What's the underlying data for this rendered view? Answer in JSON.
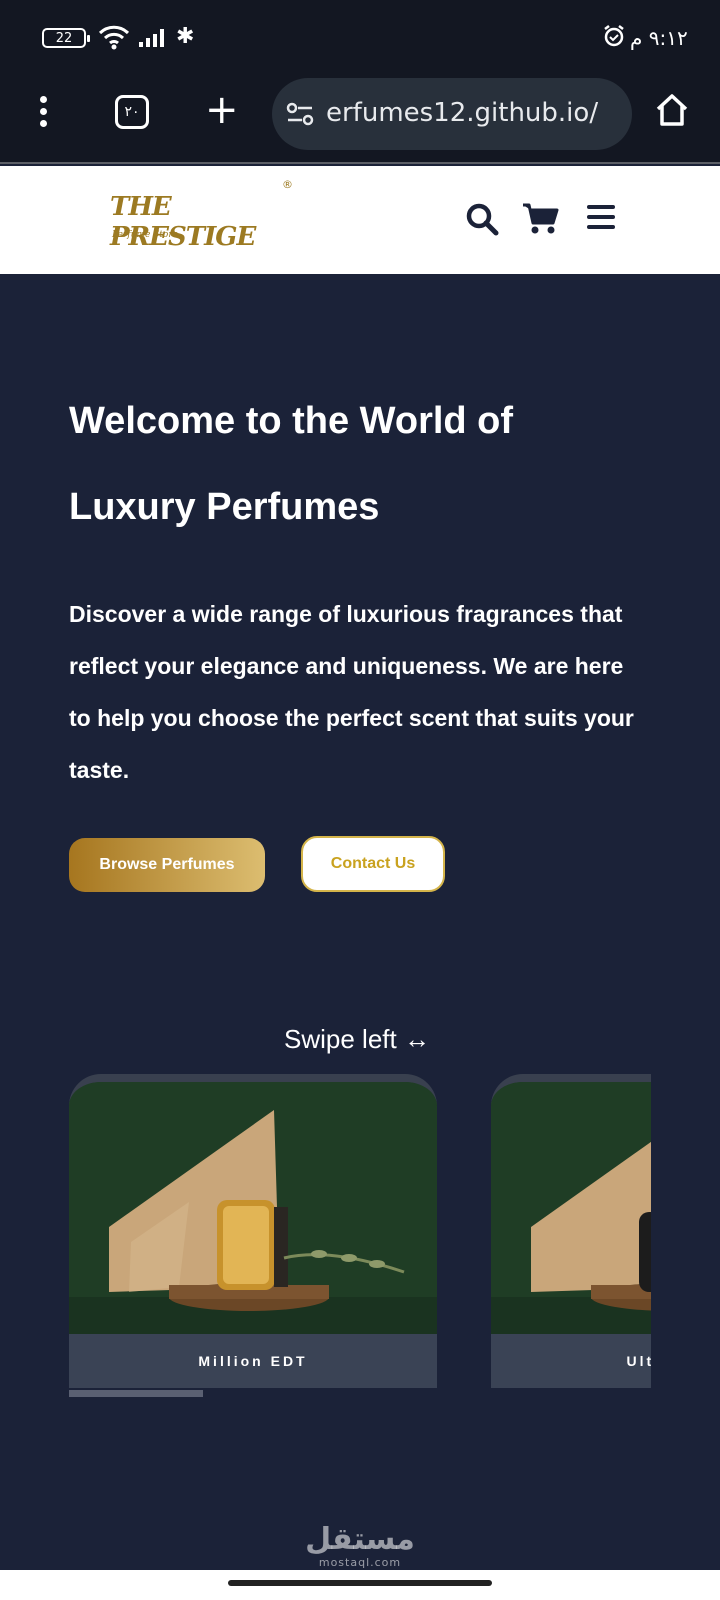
{
  "status_bar": {
    "battery": "22",
    "time": "٩:١٢ م"
  },
  "browser": {
    "tab_count": "٢٠",
    "url": "erfumes12.github.io/"
  },
  "site_header": {
    "logo_text": "THE PRESTIGE",
    "logo_tagline": "Perfume Store",
    "logo_mark": "®"
  },
  "hero": {
    "title_line1": "Welcome to the World of",
    "title_line2": "Luxury Perfumes",
    "description": "Discover a wide range of luxurious fragrances that reflect your elegance and uniqueness. We are here to help you choose the perfect scent that suits your taste.",
    "browse_label": "Browse Perfumes",
    "contact_label": "Contact Us"
  },
  "carousel": {
    "swipe_hint": "Swipe left ↔",
    "products": [
      {
        "name": "Million EDT"
      },
      {
        "name": "Ultra Male"
      }
    ],
    "scroll_progress": 0.23
  },
  "watermark": {
    "main": "مستقل",
    "sub": "mostaql.com"
  },
  "colors": {
    "page_bg": "#1b2238",
    "gold": "#c9a21f",
    "card_label_bg": "#3a4355"
  }
}
